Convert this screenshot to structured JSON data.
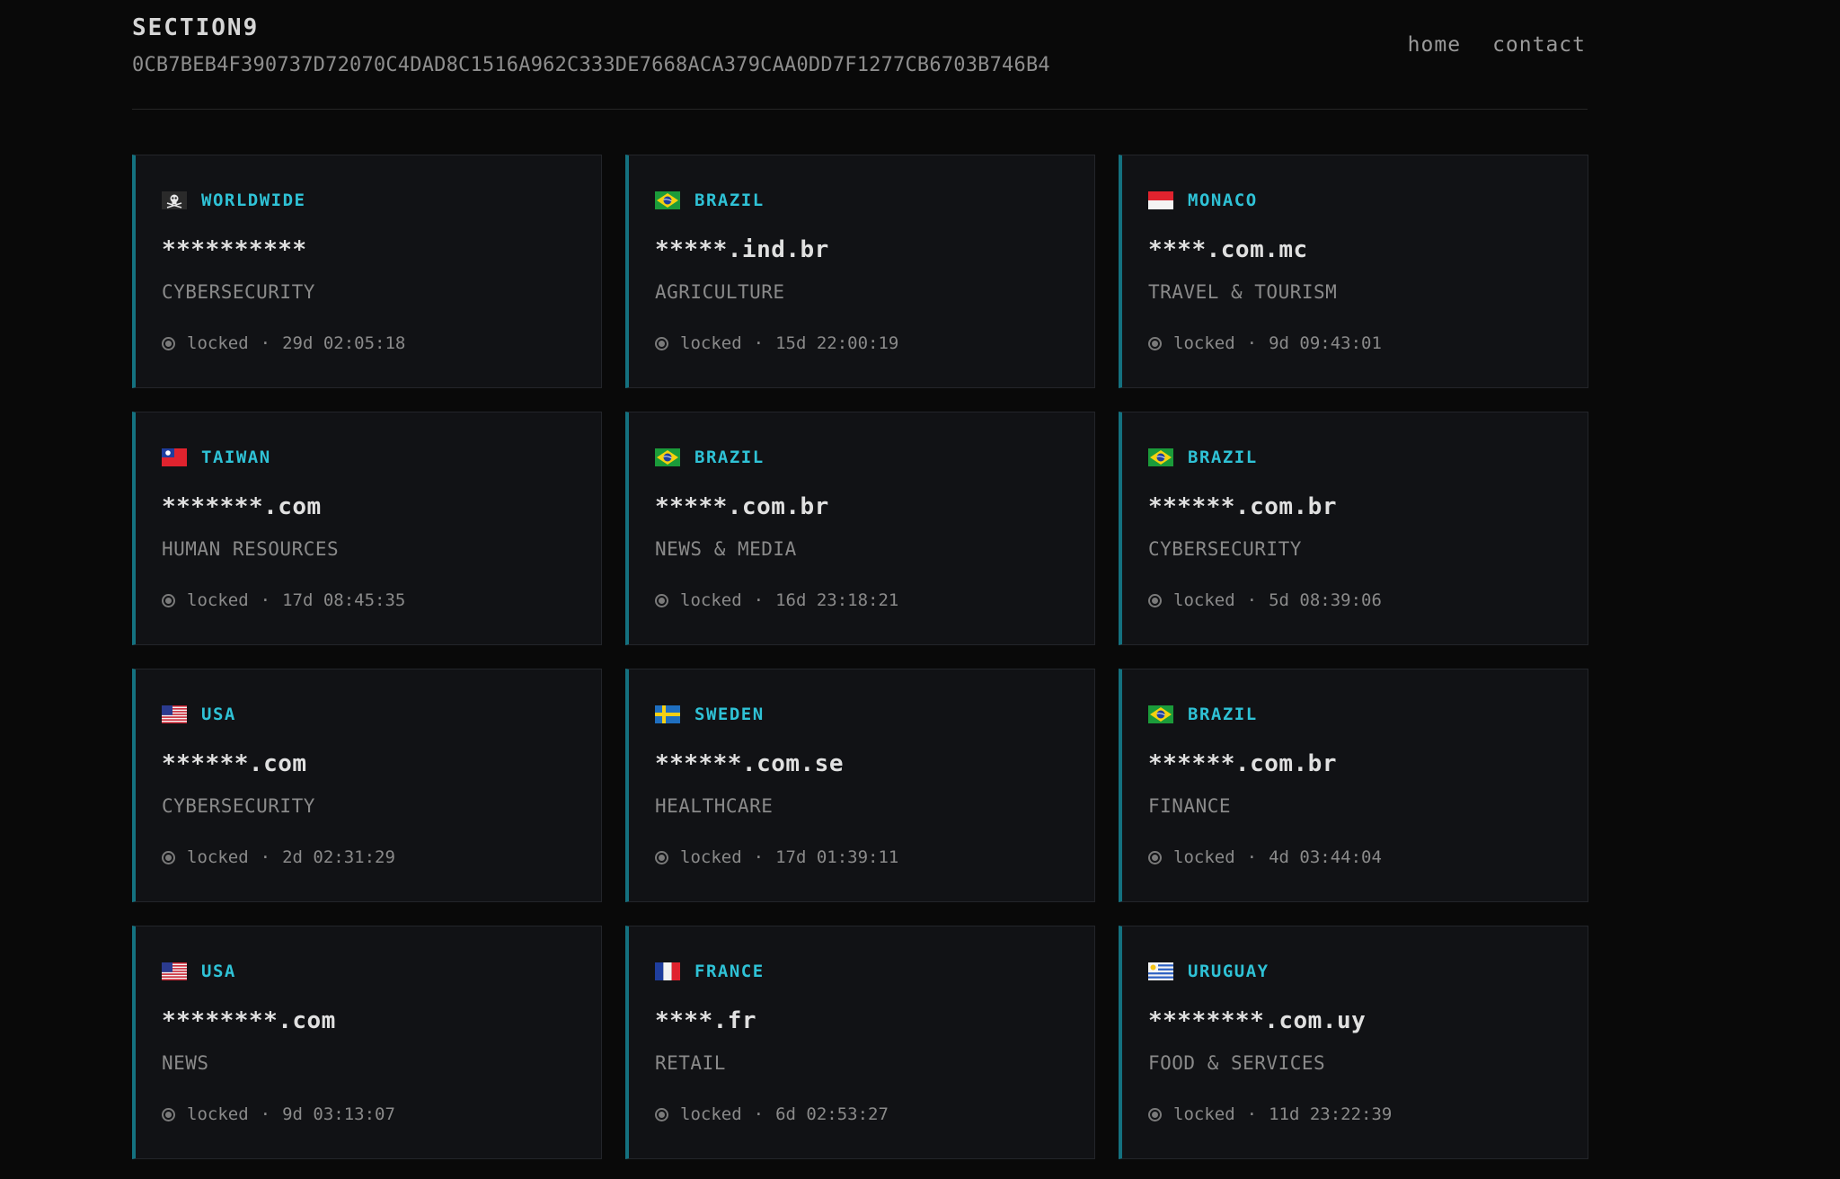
{
  "header": {
    "brand": "SECTION9",
    "hash": "0CB7BEB4F390737D72070C4DAD8C1516A962C333DE7668ACA379CAA0DD7F1277CB6703B746B4",
    "nav": {
      "home": "home",
      "contact": "contact"
    }
  },
  "colors": {
    "accent": "#2fc2d6",
    "card_border_accent": "#14717f",
    "background": "#090909"
  },
  "cards": [
    {
      "flag": "pirate-flag-icon",
      "country": "WORLDWIDE",
      "domain": "**********",
      "sector": "CYBERSECURITY",
      "status": "locked",
      "timer": "29d 02:05:18"
    },
    {
      "flag": "brazil-flag-icon",
      "country": "BRAZIL",
      "domain": "*****.ind.br",
      "sector": "AGRICULTURE",
      "status": "locked",
      "timer": "15d 22:00:19"
    },
    {
      "flag": "monaco-flag-icon",
      "country": "MONACO",
      "domain": "****.com.mc",
      "sector": "TRAVEL & TOURISM",
      "status": "locked",
      "timer": "9d 09:43:01"
    },
    {
      "flag": "taiwan-flag-icon",
      "country": "TAIWAN",
      "domain": "*******.com",
      "sector": "HUMAN RESOURCES",
      "status": "locked",
      "timer": "17d 08:45:35"
    },
    {
      "flag": "brazil-flag-icon",
      "country": "BRAZIL",
      "domain": "*****.com.br",
      "sector": "NEWS & MEDIA",
      "status": "locked",
      "timer": "16d 23:18:21"
    },
    {
      "flag": "brazil-flag-icon",
      "country": "BRAZIL",
      "domain": "******.com.br",
      "sector": "CYBERSECURITY",
      "status": "locked",
      "timer": "5d 08:39:06"
    },
    {
      "flag": "usa-flag-icon",
      "country": "USA",
      "domain": "******.com",
      "sector": "CYBERSECURITY",
      "status": "locked",
      "timer": "2d 02:31:29"
    },
    {
      "flag": "sweden-flag-icon",
      "country": "SWEDEN",
      "domain": "******.com.se",
      "sector": "HEALTHCARE",
      "status": "locked",
      "timer": "17d 01:39:11"
    },
    {
      "flag": "brazil-flag-icon",
      "country": "BRAZIL",
      "domain": "******.com.br",
      "sector": "FINANCE",
      "status": "locked",
      "timer": "4d 03:44:04"
    },
    {
      "flag": "usa-flag-icon",
      "country": "USA",
      "domain": "********.com",
      "sector": "NEWS",
      "status": "locked",
      "timer": "9d 03:13:07"
    },
    {
      "flag": "france-flag-icon",
      "country": "FRANCE",
      "domain": "****.fr",
      "sector": "RETAIL",
      "status": "locked",
      "timer": "6d 02:53:27"
    },
    {
      "flag": "uruguay-flag-icon",
      "country": "URUGUAY",
      "domain": "********.com.uy",
      "sector": "FOOD & SERVICES",
      "status": "locked",
      "timer": "11d 23:22:39"
    }
  ]
}
